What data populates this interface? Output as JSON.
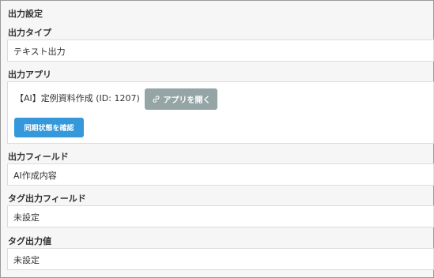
{
  "section": {
    "title": "出力設定"
  },
  "output_type": {
    "label": "出力タイプ",
    "value": "テキスト出力"
  },
  "output_app": {
    "label": "出力アプリ",
    "app_text": "【AI】定例資料作成 (ID: 1207)",
    "open_button_label": "アプリを開く",
    "sync_button_label": "同期状態を確認"
  },
  "output_field": {
    "label": "出力フィールド",
    "value": "AI作成内容"
  },
  "tag_output_field": {
    "label": "タグ出力フィールド",
    "value": "未設定"
  },
  "tag_output_value": {
    "label": "タグ出力値",
    "value": "未設定"
  },
  "icons": {
    "open_app": "link-icon"
  },
  "colors": {
    "open_button": "#95a5a6",
    "sync_button": "#3498db"
  }
}
